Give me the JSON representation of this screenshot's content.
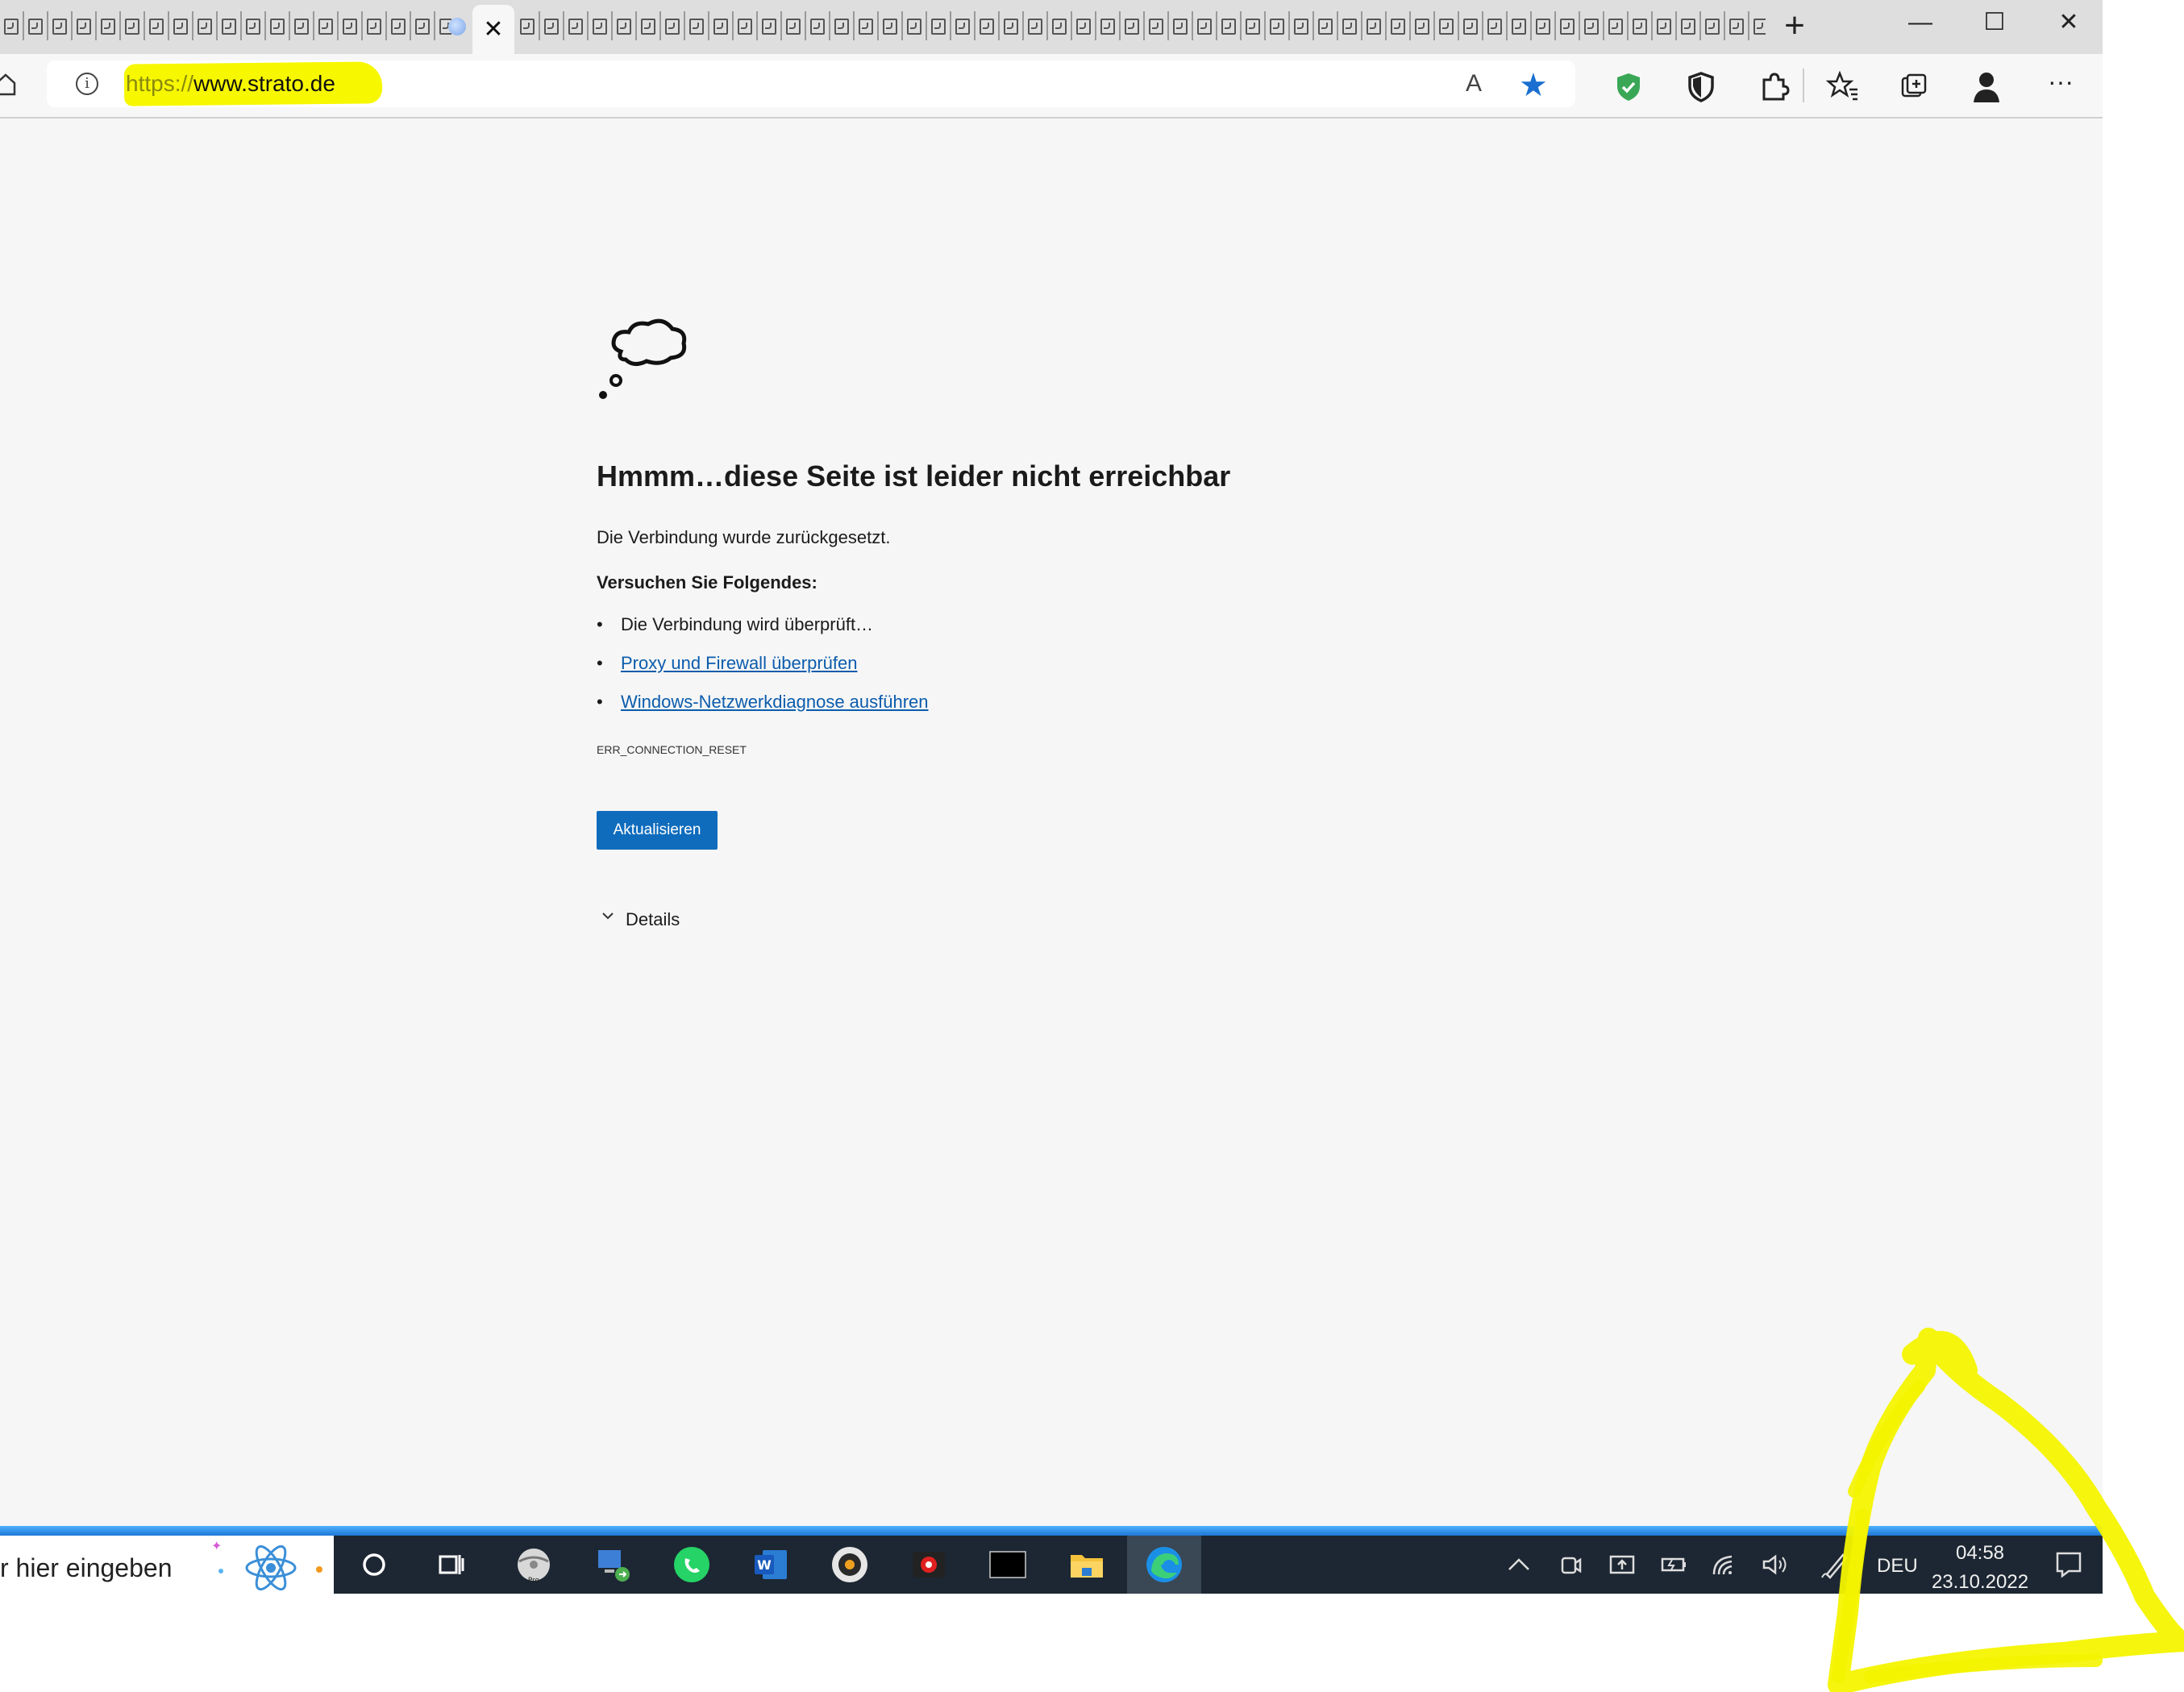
{
  "browser": {
    "active_tab": {
      "close_icon": "close-icon",
      "favicon": "loading-globe-icon"
    },
    "new_tab_label": "+",
    "window_controls": {
      "minimize": "—",
      "maximize": "☐",
      "close": "✕"
    },
    "address": {
      "protocol": "https://",
      "host": "www.strato.de"
    },
    "toolbar_icons": [
      "read-aloud-icon",
      "favorite-star-icon",
      "shield-check-icon",
      "shield-icon",
      "extensions-icon",
      "favorites-icon",
      "collections-icon",
      "profile-icon",
      "more-icon"
    ],
    "read_aloud_label": "A",
    "more_label": "···"
  },
  "error_page": {
    "heading": "Hmmm…diese Seite ist leider nicht erreichbar",
    "description": "Die Verbindung wurde zurückgesetzt.",
    "try_heading": "Versuchen Sie Folgendes:",
    "suggestions": [
      {
        "text": "Die Verbindung wird überprüft…",
        "is_link": false
      },
      {
        "text": "Proxy und Firewall überprüfen",
        "is_link": true
      },
      {
        "text": "Windows-Netzwerkdiagnose ausführen",
        "is_link": true
      }
    ],
    "error_code": "ERR_CONNECTION_RESET",
    "refresh_button": "Aktualisieren",
    "details_label": "Details"
  },
  "taskbar": {
    "search_text": "r hier eingeben",
    "apps": [
      "cortana-icon",
      "task-view-icon",
      "disk-pro-icon",
      "remote-desktop-icon",
      "whatsapp-icon",
      "word-icon",
      "media-player-icon",
      "camera-record-icon",
      "terminal-icon",
      "file-explorer-icon",
      "edge-icon"
    ],
    "tray_icons": [
      "chevron-up-icon",
      "camera-icon",
      "upload-icon",
      "battery-icon",
      "wifi-icon",
      "volume-icon",
      "pen-icon"
    ],
    "language": "DEU",
    "time": "04:58",
    "date": "23.10.2022"
  },
  "colors": {
    "accent_blue": "#0f6cbd",
    "link": "#0b5cad",
    "highlight_yellow": "#f7f700",
    "taskbar": "#1d2733"
  }
}
